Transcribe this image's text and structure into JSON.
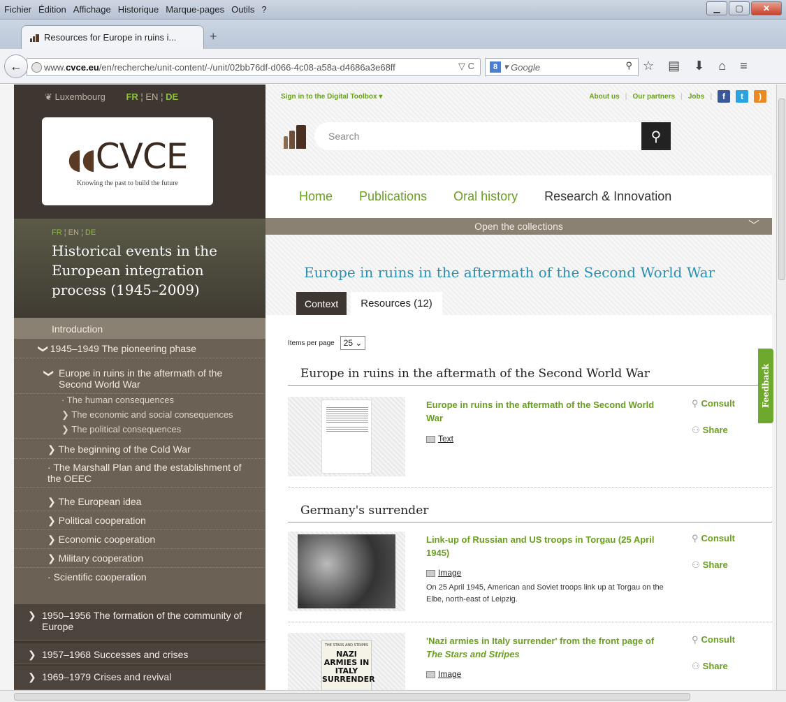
{
  "menu": [
    "Fichier",
    "Édition",
    "Affichage",
    "Historique",
    "Marque-pages",
    "Outils",
    "?"
  ],
  "tab": {
    "title": "Resources for Europe in ruins i..."
  },
  "url": {
    "prefix": "www.",
    "domain": "cvce.eu",
    "path": "/en/recherche/unit-content/-/unit/02bb76df-d066-4c08-a58a-d4686a3e68ff"
  },
  "search_engine": {
    "placeholder": "Google"
  },
  "sidebar": {
    "location": "Luxembourg",
    "langs": [
      "FR",
      "EN",
      "DE"
    ],
    "logo_text": "CVCE",
    "logo_tagline": "Knowing the past to build the future",
    "section_langs": [
      "FR",
      "EN",
      "DE"
    ],
    "section_title": "Historical events in the European integration process (1945–2009)",
    "intro": "Introduction",
    "items": [
      {
        "label": "1945–1949 The pioneering phase",
        "marker": "❯"
      },
      {
        "label": "Europe in ruins in the aftermath of the Second World War",
        "marker": "❯"
      },
      {
        "label": "The human consequences",
        "marker": "·"
      },
      {
        "label": "The economic and social consequences",
        "marker": "❯"
      },
      {
        "label": "The political consequences",
        "marker": "❯"
      },
      {
        "label": "The beginning of the Cold War",
        "marker": "❯"
      },
      {
        "label": "The Marshall Plan and the establishment of the OEEC",
        "marker": "·"
      },
      {
        "label": "The European idea",
        "marker": "❯"
      },
      {
        "label": "Political cooperation",
        "marker": "❯"
      },
      {
        "label": "Economic cooperation",
        "marker": "❯"
      },
      {
        "label": "Military cooperation",
        "marker": "❯"
      },
      {
        "label": "Scientific cooperation",
        "marker": "·"
      }
    ],
    "periods": [
      {
        "label": "1950–1956 The formation of the community of Europe"
      },
      {
        "label": "1957–1968 Successes and crises"
      },
      {
        "label": "1969–1979 Crises and revival"
      }
    ]
  },
  "header": {
    "signin": "Sign in to the Digital Toolbox ▾",
    "links": [
      "About us",
      "Our partners",
      "Jobs"
    ],
    "search_placeholder": "Search"
  },
  "nav": [
    "Home",
    "Publications",
    "Oral history",
    "Research & Innovation"
  ],
  "collections": "Open the collections",
  "page_title": "Europe in ruins in the aftermath of the Second World War",
  "tabs": {
    "context": "Context",
    "resources": "Resources (12)"
  },
  "items_per_page": {
    "label": "Items per page",
    "value": "25"
  },
  "sections": [
    {
      "title": "Europe in ruins in the aftermath of the Second World War",
      "items": [
        {
          "title": "Europe in ruins in the aftermath of the Second World War",
          "type": "Text",
          "desc": ""
        }
      ]
    },
    {
      "title": "Germany's surrender",
      "items": [
        {
          "title": "Link-up of Russian and US troops in Torgau (25 April 1945)",
          "type": "Image",
          "desc": "On 25 April 1945, American and Soviet troops link up at Torgau on the Elbe, north-east of Leipzig."
        },
        {
          "title_a": "'Nazi armies in Italy surrender' from the front page of ",
          "title_b": "The Stars and Stripes",
          "type": "Image",
          "thumb_top": "THE STARS AND STRIPES",
          "thumb_head": "NAZI ARMIES IN ITALY SURRENDER"
        }
      ]
    }
  ],
  "actions": {
    "consult": "Consult",
    "share": "Share"
  },
  "feedback": "Feedback"
}
